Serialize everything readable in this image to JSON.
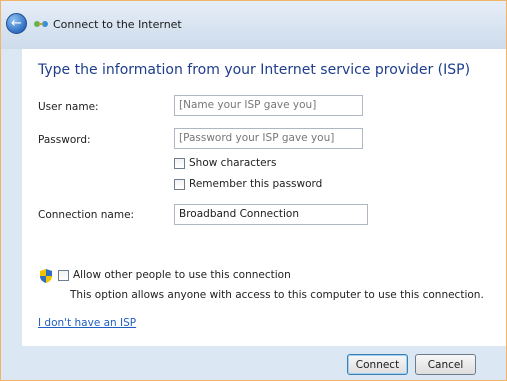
{
  "window": {
    "title": "Connect to the Internet"
  },
  "main": {
    "heading": "Type the information from your Internet service provider (ISP)",
    "username": {
      "label": "User name:",
      "placeholder": "[Name your ISP gave you]"
    },
    "password": {
      "label": "Password:",
      "placeholder": "[Password your ISP gave you]"
    },
    "show_characters": "Show characters",
    "remember_password": "Remember this password",
    "connection": {
      "label": "Connection name:",
      "value": "Broadband Connection"
    },
    "allow_others": "Allow other people to use this connection",
    "allow_desc": "This option allows anyone with access to this computer to use this connection.",
    "no_isp_link": "I don't have an ISP"
  },
  "footer": {
    "connect_label": "Connect",
    "cancel_label": "Cancel"
  },
  "colors": {
    "heading": "#1e3d8c",
    "link": "#1f5fbf",
    "frame": "#dbe8f4"
  }
}
